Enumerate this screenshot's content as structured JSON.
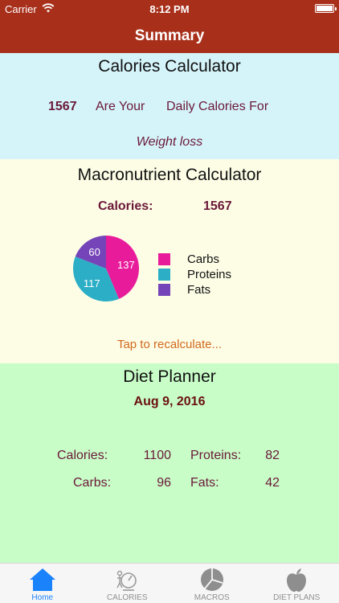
{
  "status_bar": {
    "carrier": "Carrier",
    "time": "8:12 PM"
  },
  "nav": {
    "title": "Summary"
  },
  "calories_calculator": {
    "title": "Calories Calculator",
    "calories": "1567",
    "text_are_your": "Are Your",
    "text_daily_for": "Daily Calories For",
    "goal": "Weight loss"
  },
  "macro_calculator": {
    "title": "Macronutrient Calculator",
    "calories_label": "Calories:",
    "calories_value": "1567",
    "recalculate_label": "Tap to recalculate..."
  },
  "chart_data": {
    "type": "pie",
    "categories": [
      "Carbs",
      "Proteins",
      "Fats"
    ],
    "values": [
      137,
      117,
      60
    ],
    "colors": [
      "#e81b9a",
      "#2cafc6",
      "#7444b8"
    ],
    "legend_position": "right"
  },
  "diet_planner": {
    "title": "Diet Planner",
    "date": "Aug 9, 2016",
    "calories_label": "Calories:",
    "calories_value": "1100",
    "proteins_label": "Proteins:",
    "proteins_value": "82",
    "carbs_label": "Carbs:",
    "carbs_value": "96",
    "fats_label": "Fats:",
    "fats_value": "42"
  },
  "tab_bar": {
    "items": [
      {
        "label": "Home",
        "icon": "home-icon",
        "active": true
      },
      {
        "label": "CALORIES",
        "icon": "scale-icon",
        "active": false
      },
      {
        "label": "MACROS",
        "icon": "pie-chart-icon",
        "active": false
      },
      {
        "label": "DIET PLANS",
        "icon": "apple-icon",
        "active": false
      }
    ]
  },
  "colors": {
    "header": "#a8301b",
    "calories_bg": "#d5f4fa",
    "macro_bg": "#fdfde6",
    "diet_bg": "#c8fdc8",
    "text_dark": "#6b1838",
    "accent_blue": "#1a82fb",
    "recalc": "#d2691e"
  }
}
